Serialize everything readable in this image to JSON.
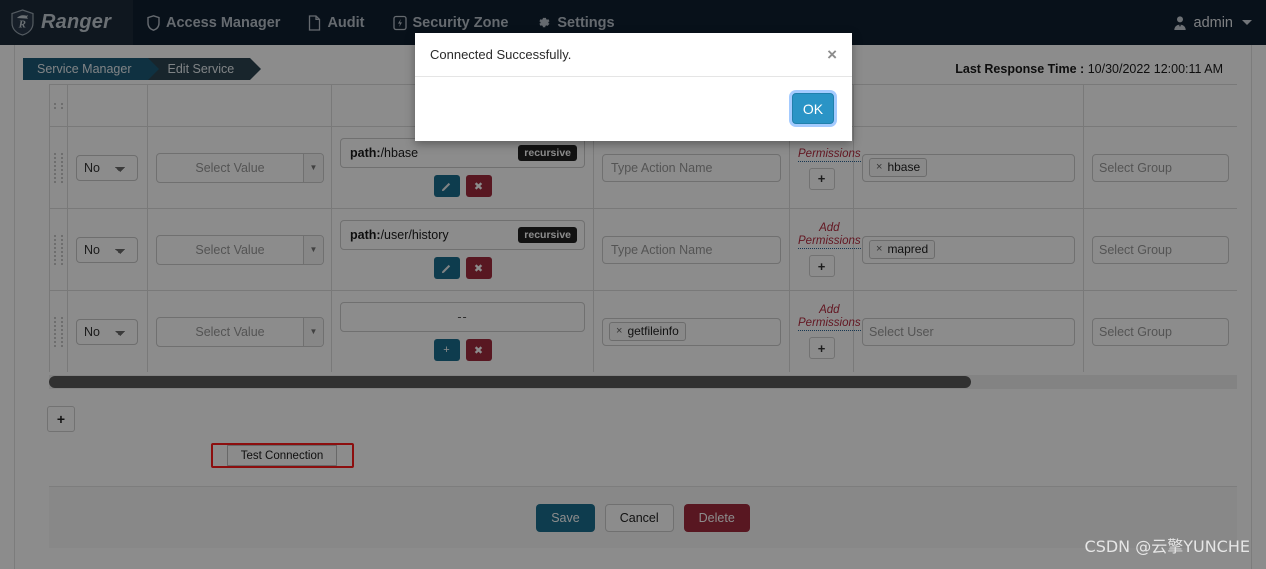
{
  "navbar": {
    "brand": "Ranger",
    "items": [
      {
        "label": "Access Manager",
        "icon": "shield-icon"
      },
      {
        "label": "Audit",
        "icon": "file-icon"
      },
      {
        "label": "Security Zone",
        "icon": "bolt-box-icon"
      },
      {
        "label": "Settings",
        "icon": "gear-icon"
      }
    ],
    "user": "admin"
  },
  "breadcrumb": {
    "items": [
      "Service Manager",
      "Edit Service"
    ]
  },
  "status": {
    "response_time_label": "Last Response Time :",
    "response_time_value": "10/30/2022 12:00:11 AM"
  },
  "table": {
    "rows": [
      {
        "recursive_select": "No",
        "value_select": "Select Value",
        "path_label": "path:",
        "path_value": "/hbase",
        "path_badge": "recursive",
        "action_placeholder": "Type Action Name",
        "action_tokens": [],
        "permissions_label_line1": "",
        "permissions_label_line2": "Permissions",
        "user_tokens": [
          "hbase"
        ],
        "user_placeholder": "",
        "group_placeholder": "Select Group"
      },
      {
        "recursive_select": "No",
        "value_select": "Select Value",
        "path_label": "path:",
        "path_value": "/user/history",
        "path_badge": "recursive",
        "action_placeholder": "Type Action Name",
        "action_tokens": [],
        "permissions_label_line1": "Add",
        "permissions_label_line2": "Permissions",
        "user_tokens": [
          "mapred"
        ],
        "user_placeholder": "",
        "group_placeholder": "Select Group"
      },
      {
        "recursive_select": "No",
        "value_select": "Select Value",
        "path_label": "",
        "path_value": "--",
        "path_badge": "",
        "action_placeholder": "",
        "action_tokens": [
          "getfileinfo"
        ],
        "permissions_label_line1": "Add",
        "permissions_label_line2": "Permissions",
        "user_tokens": [],
        "user_placeholder": "Select User",
        "group_placeholder": "Select Group"
      }
    ],
    "edit_button_icon": "pencil-icon",
    "remove_button_label": "✖",
    "add_path_button_label": "+",
    "add_permission_button_label": "+"
  },
  "actions": {
    "add_row_label": "+",
    "test_connection_label": "Test Connection",
    "save_label": "Save",
    "cancel_label": "Cancel",
    "delete_label": "Delete"
  },
  "modal": {
    "title": "Connected Successfully.",
    "close_label": "×",
    "ok_label": "OK"
  },
  "watermark": "CSDN @云擎YUNCHE",
  "colors": {
    "navbar_bg": "#101f31",
    "brand_bg": "#1c2b3a",
    "crumb_active": "#1d5a77",
    "crumb_inactive": "#2d4450",
    "teal": "#1a6e8e",
    "red": "#a02a3c",
    "perm_red": "#b52b3f",
    "ok_blue": "#2a94c6",
    "annotation_red": "#ff1a1a"
  }
}
